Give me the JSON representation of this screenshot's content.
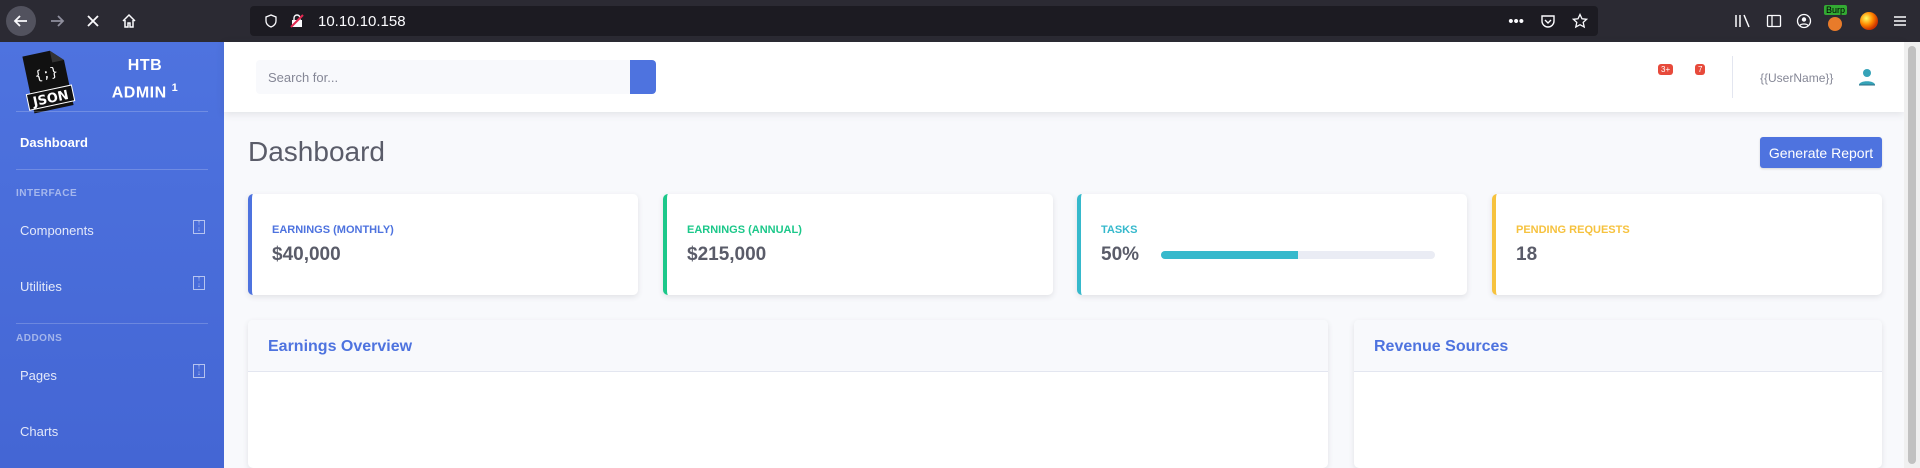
{
  "browser": {
    "url": "10.10.10.158",
    "burp_label": "Burp"
  },
  "sidebar": {
    "brand_line1": "HTB",
    "brand_line2": "ADMIN",
    "brand_sup": "1",
    "logo_text": "JSON",
    "logo_glyph": "{;}",
    "items": [
      {
        "label": "Dashboard"
      },
      {
        "label": "Components"
      },
      {
        "label": "Utilities"
      },
      {
        "label": "Pages"
      },
      {
        "label": "Charts"
      }
    ],
    "headings": [
      "INTERFACE",
      "ADDONS"
    ]
  },
  "topbar": {
    "search_placeholder": "Search for...",
    "alerts_count": "3+",
    "messages_count": "7",
    "username": "{{UserName}}"
  },
  "main": {
    "title": "Dashboard",
    "generate_report": "Generate Report",
    "cards": [
      {
        "label": "Earnings (Monthly)",
        "value": "$40,000",
        "color": "#4e73df"
      },
      {
        "label": "Earnings (Annual)",
        "value": "$215,000",
        "color": "#1cc88a"
      },
      {
        "label": "Tasks",
        "value": "50%",
        "progress": 0.5,
        "color": "#36b9cc"
      },
      {
        "label": "Pending Requests",
        "value": "18",
        "color": "#f6c23e"
      }
    ],
    "panels": [
      {
        "title": "Earnings Overview"
      },
      {
        "title": "Revenue Sources"
      }
    ]
  }
}
